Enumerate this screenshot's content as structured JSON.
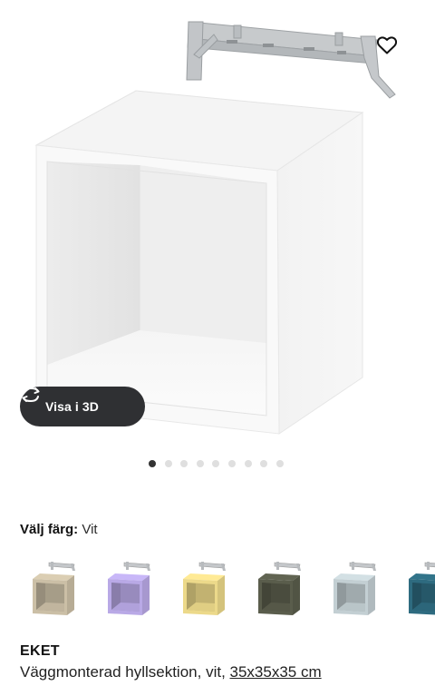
{
  "view3d": {
    "label": "Visa i 3D",
    "icon": "rotate-3d-icon"
  },
  "favorite": {
    "icon": "heart-icon"
  },
  "carousel": {
    "count": 9,
    "active_index": 0
  },
  "color_picker": {
    "label": "Välj färg:",
    "selected": "Vit",
    "swatches": [
      {
        "color": "#cbbfa6"
      },
      {
        "color": "#b9a9e6"
      },
      {
        "color": "#ecd98a"
      },
      {
        "color": "#5a5d4c"
      },
      {
        "color": "#c3cfd3"
      },
      {
        "color": "#2e6b80"
      }
    ]
  },
  "product": {
    "name": "EKET",
    "description": "Väggmonterad hyllsektion, vit, ",
    "size": "35x35x35 cm"
  }
}
